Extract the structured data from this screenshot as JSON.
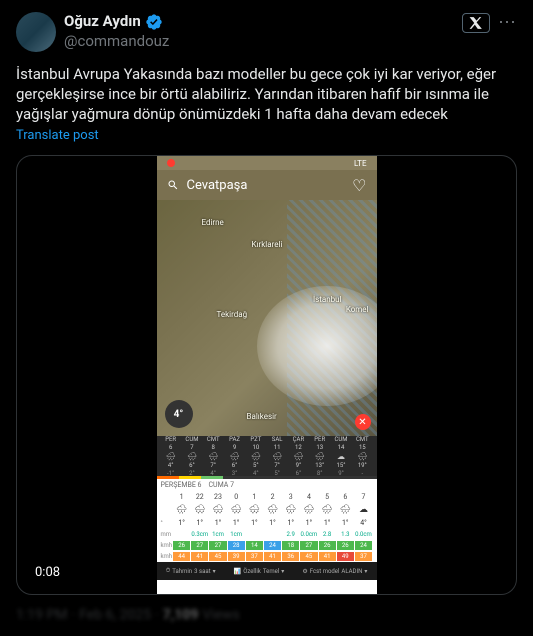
{
  "user": {
    "displayName": "Oğuz Aydın",
    "handle": "@commandouz",
    "verified": true
  },
  "tweet": {
    "text": "İstanbul Avrupa Yakasında bazı modeller bu gece çok iyi kar veriyor, eğer gerçekleşirse ince bir örtü alabiliriz. Yarından itibaren hafif bir ısınma ile yağışlar yağmura dönüp önümüzdeki 1 hafta daha devam edecek",
    "translateLabel": "Translate post"
  },
  "video": {
    "timestamp": "0:08"
  },
  "weather": {
    "statusBar": {
      "carrier": "LTE"
    },
    "searchLocation": "Cevatpaşa",
    "currentTemp": "4°",
    "cities": {
      "edirne": "Edirne",
      "kirklareli": "Kırklareli",
      "tekirdag": "Tekirdağ",
      "balikesir": "Balıkesir",
      "istanbul": "İstanbul",
      "komel": "Komel"
    },
    "forecast": [
      {
        "day": "PER",
        "date": "6",
        "icon": "🌧",
        "hi": "4°",
        "lo": "-1°"
      },
      {
        "day": "CUM",
        "date": "7",
        "icon": "🌧",
        "hi": "6°",
        "lo": "2°"
      },
      {
        "day": "CMT",
        "date": "8",
        "icon": "🌧",
        "hi": "7°",
        "lo": "4°"
      },
      {
        "day": "PAZ",
        "date": "9",
        "icon": "🌧",
        "hi": "6°",
        "lo": "3°"
      },
      {
        "day": "PZT",
        "date": "10",
        "icon": "🌧",
        "hi": "5°",
        "lo": "4°"
      },
      {
        "day": "SAL",
        "date": "11",
        "icon": "🌧",
        "hi": "7°",
        "lo": "5°"
      },
      {
        "day": "ÇAR",
        "date": "12",
        "icon": "🌧",
        "hi": "9°",
        "lo": "6°"
      },
      {
        "day": "PER",
        "date": "13",
        "icon": "🌧",
        "hi": "13°",
        "lo": "8°"
      },
      {
        "day": "CUM",
        "date": "14",
        "icon": "☁",
        "hi": "15°",
        "lo": "9°"
      },
      {
        "day": "CMT",
        "date": "15",
        "icon": "🌧",
        "hi": "19°",
        "lo": "-"
      }
    ],
    "detail": {
      "dayLabels": {
        "thu": "PERŞEMBE 6",
        "fri": "CUMA 7"
      },
      "hours": [
        "1",
        "22",
        "23",
        "0",
        "1",
        "2",
        "3",
        "4",
        "5",
        "6",
        "7"
      ],
      "icons": [
        "🌧",
        "🌨",
        "🌨",
        "🌨",
        "🌨",
        "🌧",
        "🌧",
        "🌧",
        "🌧",
        "🌧",
        "☁"
      ],
      "temps": [
        "1°",
        "1°",
        "1°",
        "1°",
        "1°",
        "1°",
        "1°",
        "1°",
        "1°",
        "1°",
        "4°"
      ],
      "precip": [
        "",
        "0.3cm",
        "1cm",
        "1cm",
        "",
        "",
        "2.9",
        "0.0cm",
        "2.8",
        "1.3",
        "0.0cm"
      ],
      "wind1": [
        "26",
        "27",
        "27",
        "28",
        "14",
        "24",
        "18",
        "27",
        "26",
        "26",
        "24"
      ],
      "wind2": [
        "44",
        "41",
        "45",
        "39",
        "37",
        "41",
        "36",
        "45",
        "41",
        "49",
        "37"
      ]
    },
    "bottomBar": {
      "tahmin": {
        "label": "Tahmin",
        "value": "3 saat"
      },
      "ozellik": {
        "label": "Özellik",
        "value": "Temel"
      },
      "model": {
        "label": "Fcst model",
        "value": "ALADIN"
      }
    }
  },
  "meta": {
    "time": "1:19 PM",
    "date": "Feb 6, 2025",
    "views": "7,109",
    "viewsLabel": "Views"
  }
}
